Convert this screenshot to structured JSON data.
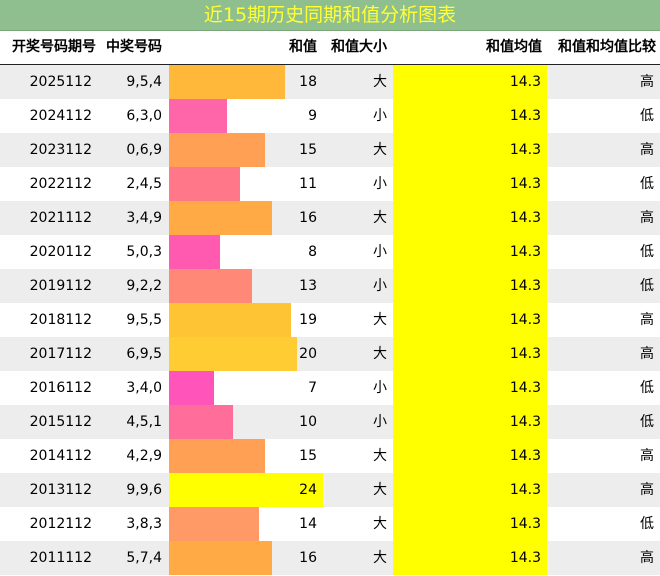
{
  "title": "近15期历史同期和值分析图表",
  "headers": {
    "period": "开奖号码期号",
    "numbers": "中奖号码",
    "sum": "和值",
    "size": "和值大小",
    "avg": "和值均值",
    "compare": "和值和均值比较"
  },
  "chart_data": {
    "type": "table",
    "title": "近15期历史同期和值分析图表",
    "columns": [
      "开奖号码期号",
      "中奖号码",
      "和值",
      "和值大小",
      "和值均值",
      "和值和均值比较"
    ],
    "rows": [
      {
        "period": "2025112",
        "numbers": "9,5,4",
        "sum": 18,
        "size": "大",
        "avg": "14.3",
        "compare": "高"
      },
      {
        "period": "2024112",
        "numbers": "6,3,0",
        "sum": 9,
        "size": "小",
        "avg": "14.3",
        "compare": "低"
      },
      {
        "period": "2023112",
        "numbers": "0,6,9",
        "sum": 15,
        "size": "大",
        "avg": "14.3",
        "compare": "高"
      },
      {
        "period": "2022112",
        "numbers": "2,4,5",
        "sum": 11,
        "size": "小",
        "avg": "14.3",
        "compare": "低"
      },
      {
        "period": "2021112",
        "numbers": "3,4,9",
        "sum": 16,
        "size": "大",
        "avg": "14.3",
        "compare": "高"
      },
      {
        "period": "2020112",
        "numbers": "5,0,3",
        "sum": 8,
        "size": "小",
        "avg": "14.3",
        "compare": "低"
      },
      {
        "period": "2019112",
        "numbers": "9,2,2",
        "sum": 13,
        "size": "小",
        "avg": "14.3",
        "compare": "低"
      },
      {
        "period": "2018112",
        "numbers": "9,5,5",
        "sum": 19,
        "size": "大",
        "avg": "14.3",
        "compare": "高"
      },
      {
        "period": "2017112",
        "numbers": "6,9,5",
        "sum": 20,
        "size": "大",
        "avg": "14.3",
        "compare": "高"
      },
      {
        "period": "2016112",
        "numbers": "3,4,0",
        "sum": 7,
        "size": "小",
        "avg": "14.3",
        "compare": "低"
      },
      {
        "period": "2015112",
        "numbers": "4,5,1",
        "sum": 10,
        "size": "小",
        "avg": "14.3",
        "compare": "低"
      },
      {
        "period": "2014112",
        "numbers": "4,2,9",
        "sum": 15,
        "size": "大",
        "avg": "14.3",
        "compare": "高"
      },
      {
        "period": "2013112",
        "numbers": "9,9,6",
        "sum": 24,
        "size": "大",
        "avg": "14.3",
        "compare": "高"
      },
      {
        "period": "2012112",
        "numbers": "3,8,3",
        "sum": 14,
        "size": "大",
        "avg": "14.3",
        "compare": "低"
      },
      {
        "period": "2011112",
        "numbers": "5,7,4",
        "sum": 16,
        "size": "大",
        "avg": "14.3",
        "compare": "高"
      }
    ],
    "sum_scale_max": 24,
    "bar_colors": {
      "7": "#ff55bb",
      "8": "#ff5ab0",
      "9": "#ff66aa",
      "10": "#ff6e9a",
      "11": "#ff7788",
      "13": "#ff8877",
      "14": "#ff9966",
      "15": "#ffa055",
      "16": "#ffaa44",
      "18": "#ffb83a",
      "19": "#ffc433",
      "20": "#ffcc33",
      "24": "#ffff00"
    },
    "avg_highlight_color": "#ffff00",
    "title_bg_color": "#8fbf8f",
    "title_text_color": "#ffff33"
  }
}
